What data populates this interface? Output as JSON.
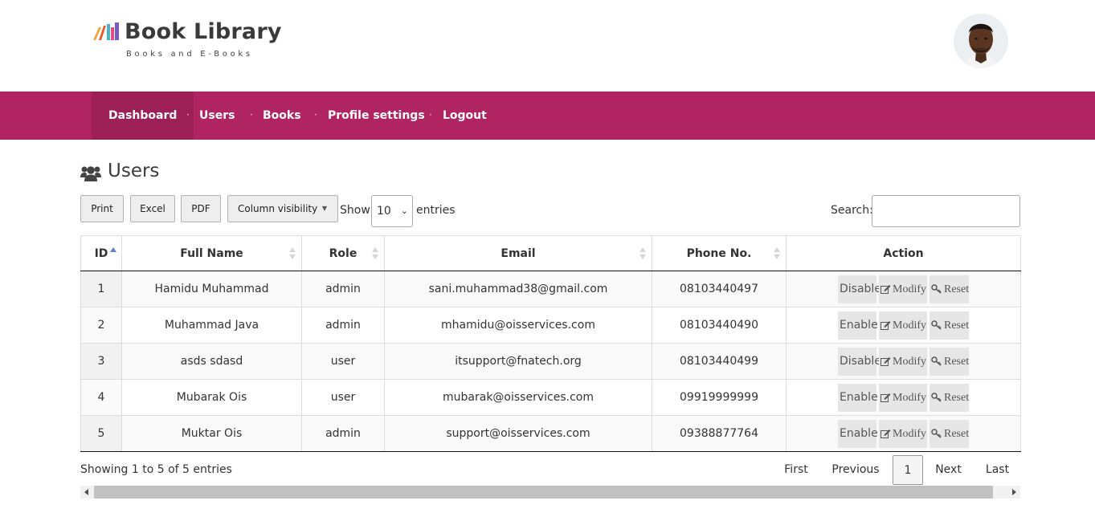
{
  "brand": {
    "title": "Book Library",
    "subtitle": "Books and E-Books"
  },
  "nav": {
    "items": [
      {
        "label": "Dashboard"
      },
      {
        "label": "Users"
      },
      {
        "label": "Books"
      },
      {
        "label": "Profile settings"
      },
      {
        "label": "Logout"
      }
    ],
    "active": "Dashboard",
    "color": "#b12462"
  },
  "page": {
    "title": "Users",
    "icon": "users-icon"
  },
  "toolbar": {
    "print_label": "Print",
    "excel_label": "Excel",
    "pdf_label": "PDF",
    "colvis_label": "Column visibility",
    "show_label": "Show",
    "entries_value": "10",
    "entries_label": "entries",
    "search_label": "Search:",
    "search_value": ""
  },
  "table": {
    "columns": [
      "ID",
      "Full Name",
      "Role",
      "Email",
      "Phone No.",
      "Action"
    ],
    "rows": [
      {
        "id": "1",
        "name": "Hamidu Muhammad",
        "role": "admin",
        "email": "sani.muhammad38@gmail.com",
        "phone": "08103440497",
        "toggle": "Disable",
        "modify": "Modify",
        "reset": "Reset"
      },
      {
        "id": "2",
        "name": "Muhammad Java",
        "role": "admin",
        "email": "mhamidu@oisservices.com",
        "phone": "08103440490",
        "toggle": "Enable",
        "modify": "Modify",
        "reset": "Reset"
      },
      {
        "id": "3",
        "name": "asds sdasd",
        "role": "user",
        "email": "itsupport@fnatech.org",
        "phone": "08103440499",
        "toggle": "Disable",
        "modify": "Modify",
        "reset": "Reset"
      },
      {
        "id": "4",
        "name": "Mubarak Ois",
        "role": "user",
        "email": "mubarak@oisservices.com",
        "phone": "09919999999",
        "toggle": "Enable",
        "modify": "Modify",
        "reset": "Reset"
      },
      {
        "id": "5",
        "name": "Muktar Ois",
        "role": "admin",
        "email": "support@oisservices.com",
        "phone": "09388877764",
        "toggle": "Enable",
        "modify": "Modify",
        "reset": "Reset"
      }
    ]
  },
  "footer": {
    "info": "Showing 1 to 5 of 5 entries",
    "pagination": {
      "first": "First",
      "previous": "Previous",
      "current": "1",
      "next": "Next",
      "last": "Last"
    }
  }
}
